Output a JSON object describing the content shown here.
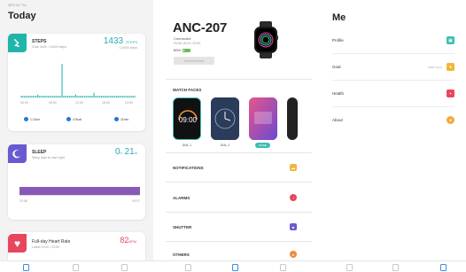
{
  "today": {
    "date_label": "WED 04, Thu",
    "title": "Today",
    "steps": {
      "label": "STEPS",
      "sublabel": "Goal: 6000 / 10000 steps",
      "value": "1433",
      "unit": "STEPS",
      "value_hint": "/ 10000 steps",
      "axis_labels": [
        "00:00",
        "06:00",
        "12:00",
        "18:00",
        "23:59"
      ],
      "stats": [
        {
          "value": "1.11km"
        },
        {
          "value": "47kcal"
        },
        {
          "value": "11min"
        }
      ],
      "bars": [
        1,
        1,
        1,
        1,
        1,
        1,
        1,
        1,
        1,
        1,
        1,
        2,
        1,
        1,
        1,
        1,
        1,
        1,
        1,
        1,
        1,
        1,
        1,
        1,
        1,
        1,
        1,
        22,
        1,
        1,
        1,
        1,
        1,
        1,
        1,
        1,
        2,
        1,
        1,
        1,
        1,
        1,
        1,
        1,
        1,
        1,
        1,
        1,
        3,
        1,
        1,
        1,
        1,
        1,
        1,
        1,
        1,
        1,
        1,
        1,
        1,
        1,
        1,
        1,
        1,
        1,
        1,
        1,
        1,
        1,
        1,
        1,
        1,
        1,
        1,
        1
      ]
    },
    "sleep": {
      "label": "SLEEP",
      "sublabel": "Sleep data for last night",
      "hours": "0",
      "hours_unit": "h",
      "minutes": "21",
      "minutes_unit": "m",
      "axis_start": "20:08",
      "axis_end": "09:07"
    },
    "heart": {
      "label": "Full-day Heart Rate",
      "sublabel": "Latest 00:00 / 23:59",
      "value": "82",
      "unit": "BPM"
    }
  },
  "device": {
    "name": "ANC-207",
    "status": "Connected",
    "mac": "00:8A:1B:4C:7D:6E",
    "battery": "89%",
    "button_label": "Unbind Device",
    "watch_faces_title": "WATCH FACES",
    "faces": [
      {
        "label": "DIAL 1",
        "time": "09:00"
      },
      {
        "label": "DIAL 2",
        "time": ""
      },
      {
        "label": "",
        "time": ""
      }
    ],
    "more_pill": "MORE",
    "rows": [
      {
        "label": "NOTIFICATIONS",
        "color": "#f2b43a",
        "glyph": "▬"
      },
      {
        "label": "ALARMS",
        "color": "#e8465d",
        "glyph": "◔"
      },
      {
        "label": "SHUTTER",
        "color": "#6a5ad1",
        "glyph": "■"
      },
      {
        "label": "OTHERS",
        "color": "#f08a3a",
        "glyph": "●"
      }
    ]
  },
  "me": {
    "title": "Me",
    "rows": [
      {
        "label": "Profile",
        "hint": "",
        "color": "#3bbfb0",
        "glyph": "▣"
      },
      {
        "label": "Goal",
        "hint": "10000 steps",
        "color": "#f2b43a",
        "glyph": "♦"
      },
      {
        "label": "Health",
        "hint": "",
        "color": "#e8465d",
        "glyph": "▪"
      },
      {
        "label": "About",
        "hint": "",
        "color": "#f2a93a",
        "glyph": "●"
      }
    ]
  },
  "nav": {
    "panel1_active": 0,
    "panel2_active": 1,
    "panel3_active": 2
  },
  "colors": {
    "accent_teal": "#1fb5a8",
    "sleep_purple": "#8758b8",
    "heart_red": "#e8465d",
    "nav_active": "#3b8de0"
  }
}
